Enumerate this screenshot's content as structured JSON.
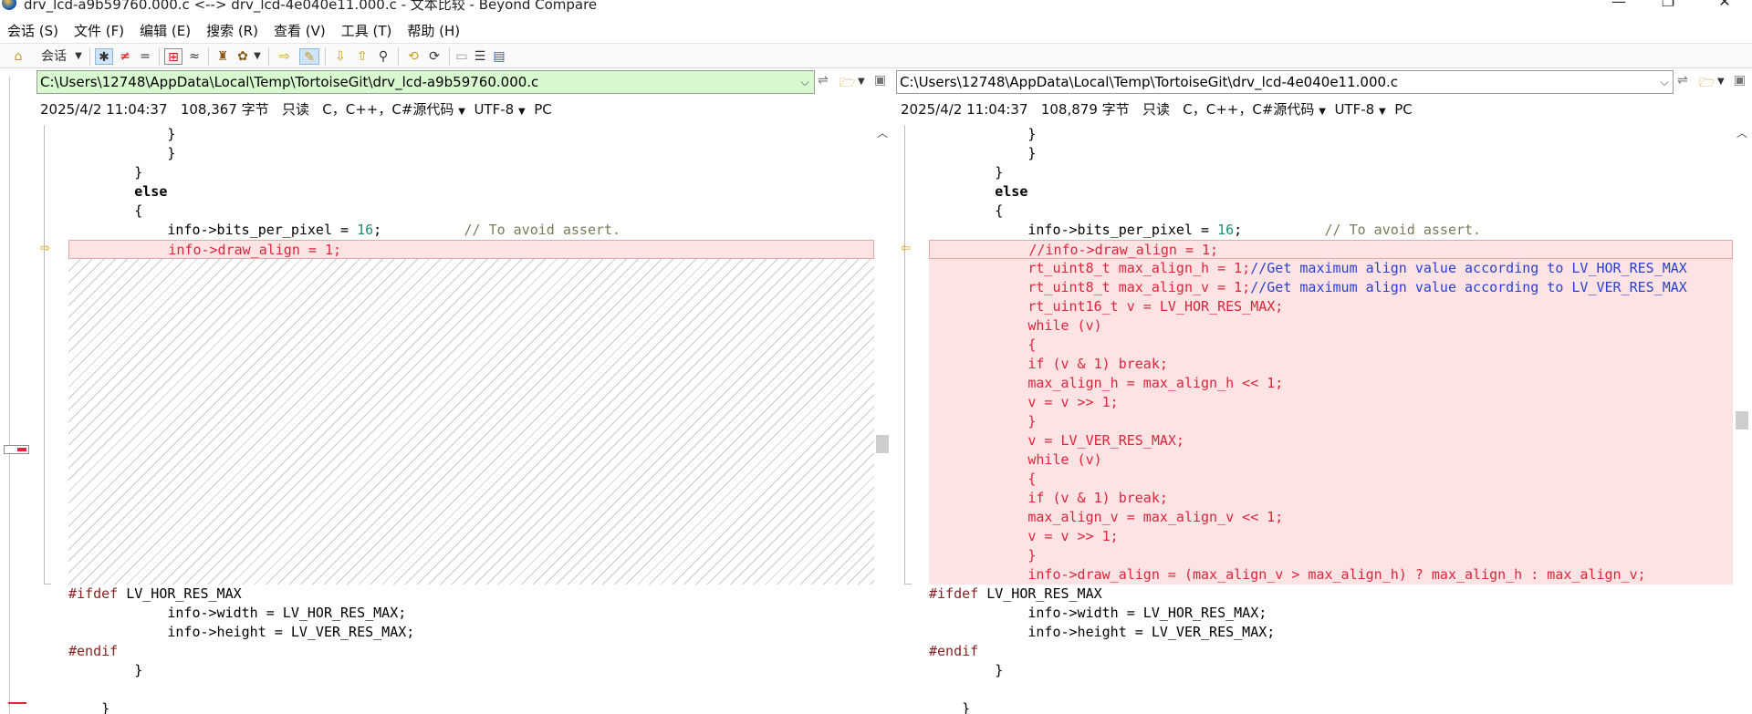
{
  "window": {
    "title": "drv_lcd-a9b59760.000.c <--> drv_lcd-4e040e11.000.c - 文本比较 - Beyond Compare"
  },
  "menu": [
    "会话 (S)",
    "文件 (F)",
    "编辑 (E)",
    "搜索 (R)",
    "查看 (V)",
    "工具 (T)",
    "帮助 (H)"
  ],
  "toolbar": {
    "session_label": "会话"
  },
  "left": {
    "path": "C:\\Users\\12748\\AppData\\Local\\Temp\\TortoiseGit\\drv_lcd-a9b59760.000.c",
    "date": "2025/4/2 11:04:37",
    "size": "108,367 字节",
    "readonly": "只读",
    "format": "C，C++，C#源代码",
    "encoding": "UTF-8",
    "lineend": "PC"
  },
  "right": {
    "path": "C:\\Users\\12748\\AppData\\Local\\Temp\\TortoiseGit\\drv_lcd-4e040e11.000.c",
    "date": "2025/4/2 11:04:37",
    "size": "108,879 字节",
    "readonly": "只读",
    "format": "C，C++，C#源代码",
    "encoding": "UTF-8",
    "lineend": "PC"
  },
  "code": {
    "common_top": [
      "            }",
      "            }",
      "        }",
      "        else",
      "        {",
      "            info->bits_per_pixel = 16;          // To avoid assert."
    ],
    "left_diff": "            info->draw_align = 1;",
    "right_diff": [
      "            //info->draw_align = 1;",
      "            rt_uint8_t max_align_h = 1;//Get maximum align value according to LV_HOR_RES_MAX",
      "            rt_uint8_t max_align_v = 1;//Get maximum align value according to LV_VER_RES_MAX",
      "            rt_uint16_t v = LV_HOR_RES_MAX;",
      "            while (v)",
      "            {",
      "            if (v & 1) break;",
      "            max_align_h = max_align_h << 1;",
      "            v = v >> 1;",
      "            }",
      "            v = LV_VER_RES_MAX;",
      "            while (v)",
      "            {",
      "            if (v & 1) break;",
      "            max_align_v = max_align_v << 1;",
      "            v = v >> 1;",
      "            }",
      "            info->draw_align = (max_align_v > max_align_h) ? max_align_h : max_align_v;"
    ],
    "common_bottom": [
      "#ifdef LV_HOR_RES_MAX",
      "            info->width = LV_HOR_RES_MAX;",
      "            info->height = LV_VER_RES_MAX;",
      "#endif",
      "        }",
      "",
      "    }"
    ]
  },
  "colors": {
    "diff_text": "#e0243a",
    "diff_bg": "#fde3e3",
    "left_path_bg": "#d8f8d0"
  }
}
